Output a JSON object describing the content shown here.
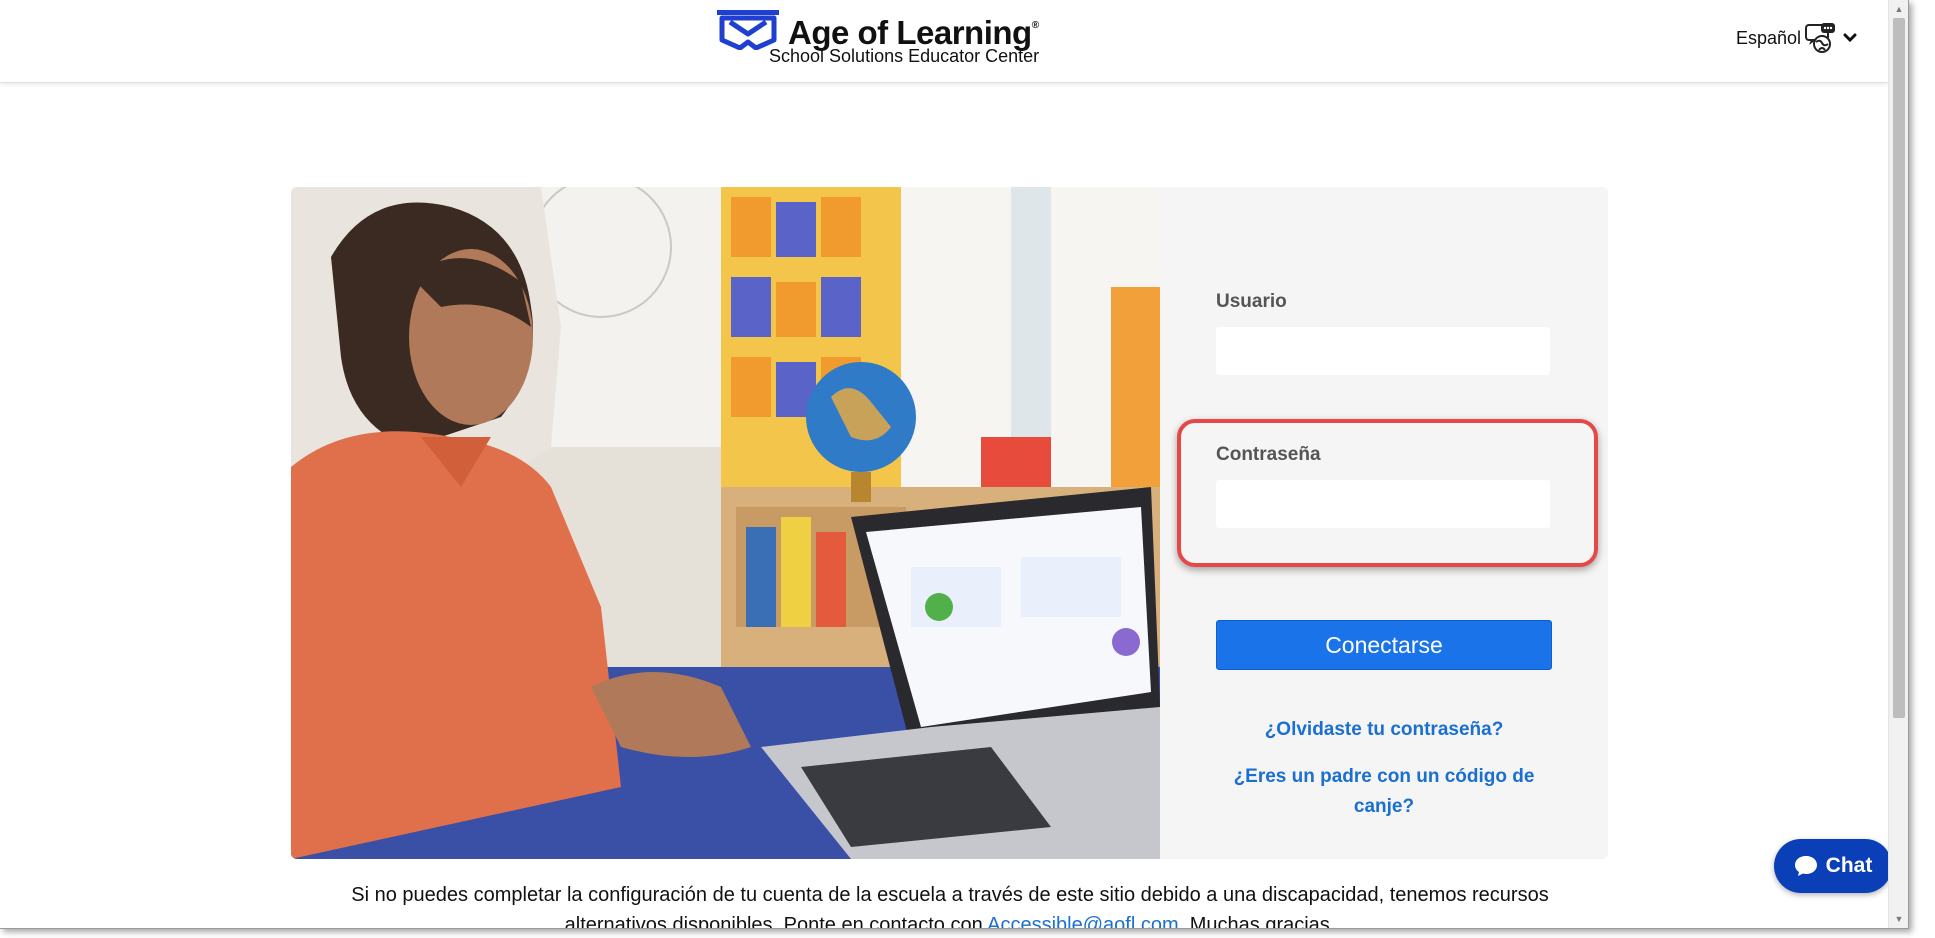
{
  "header": {
    "brand_name": "Age of Learning",
    "brand_mark": "®",
    "subtitle": "School Solutions Educator Center",
    "language_label": "Español",
    "language_icon": "language-globe-icon"
  },
  "login": {
    "username_label": "Usuario",
    "username_value": "",
    "password_label": "Contraseña",
    "password_value": "",
    "submit_label": "Conectarse",
    "forgot_password_link": "¿Olvidaste tu contraseña?",
    "parent_code_link": "¿Eres un padre con un código de canje?"
  },
  "footer": {
    "accessibility_text_1": "Si no puedes completar la configuración de tu cuenta de la escuela a través de este sitio debido a una discapacidad, tenemos recursos alternativos disponibles. Ponte en contacto con",
    "accessibility_email": "Accessible@aofl.com",
    "accessibility_text_2": ". Muchas gracias."
  },
  "chat": {
    "label": "Chat",
    "icon": "chat-bubble-icon"
  },
  "colors": {
    "accent": "#1a73e8",
    "link": "#1a6fd1",
    "highlight": "#e54848",
    "chat_bg": "#0b3fb8"
  }
}
